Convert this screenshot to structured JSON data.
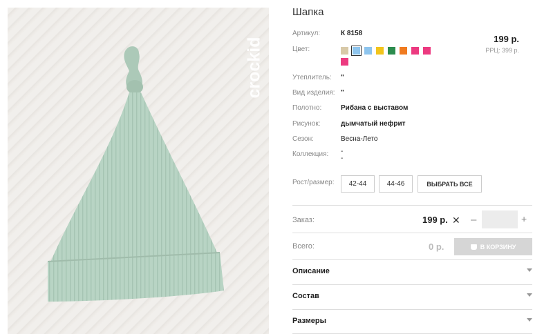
{
  "brand": {
    "logo_text": "crockid"
  },
  "product": {
    "title": "Шапка",
    "price": "199 р.",
    "rrc": "РРЦ: 399 р."
  },
  "attributes": {
    "article_label": "Артикул:",
    "article_value": "К 8158",
    "color_label": "Цвет:",
    "insulation_label": "Утеплитель:",
    "insulation_value": "\"",
    "kind_label": "Вид изделия:",
    "kind_value": "\"",
    "fabric_label": "Полотно:",
    "fabric_value": "Рибана с выставом",
    "pattern_label": "Рисунок:",
    "pattern_value": "дымчатый нефрит",
    "season_label": "Сезон:",
    "season_value": "Весна-Лето",
    "collection_label": "Коллекция:",
    "collection_value_1": "-",
    "collection_value_2": "-"
  },
  "colors": [
    "#d8c9a8",
    "#8ec5ee",
    "#8ec5ee",
    "#f2c41b",
    "#2c8c4e",
    "#f07b20",
    "#ec3a80",
    "#ec3a80",
    "#ec3a80"
  ],
  "sizes": {
    "label": "Рост/размер:",
    "options": [
      "42-44",
      "44-46"
    ],
    "select_all": "ВЫБРАТЬ ВСЕ"
  },
  "order": {
    "label": "Заказ:",
    "price": "199 р.",
    "remove_symbol": "✕",
    "minus": "–",
    "plus": "+",
    "quantity": ""
  },
  "total": {
    "label": "Всего:",
    "value": "0 р.",
    "cart_button": "В КОРЗИНУ"
  },
  "accordion": [
    "Описание",
    "Состав",
    "Размеры"
  ]
}
